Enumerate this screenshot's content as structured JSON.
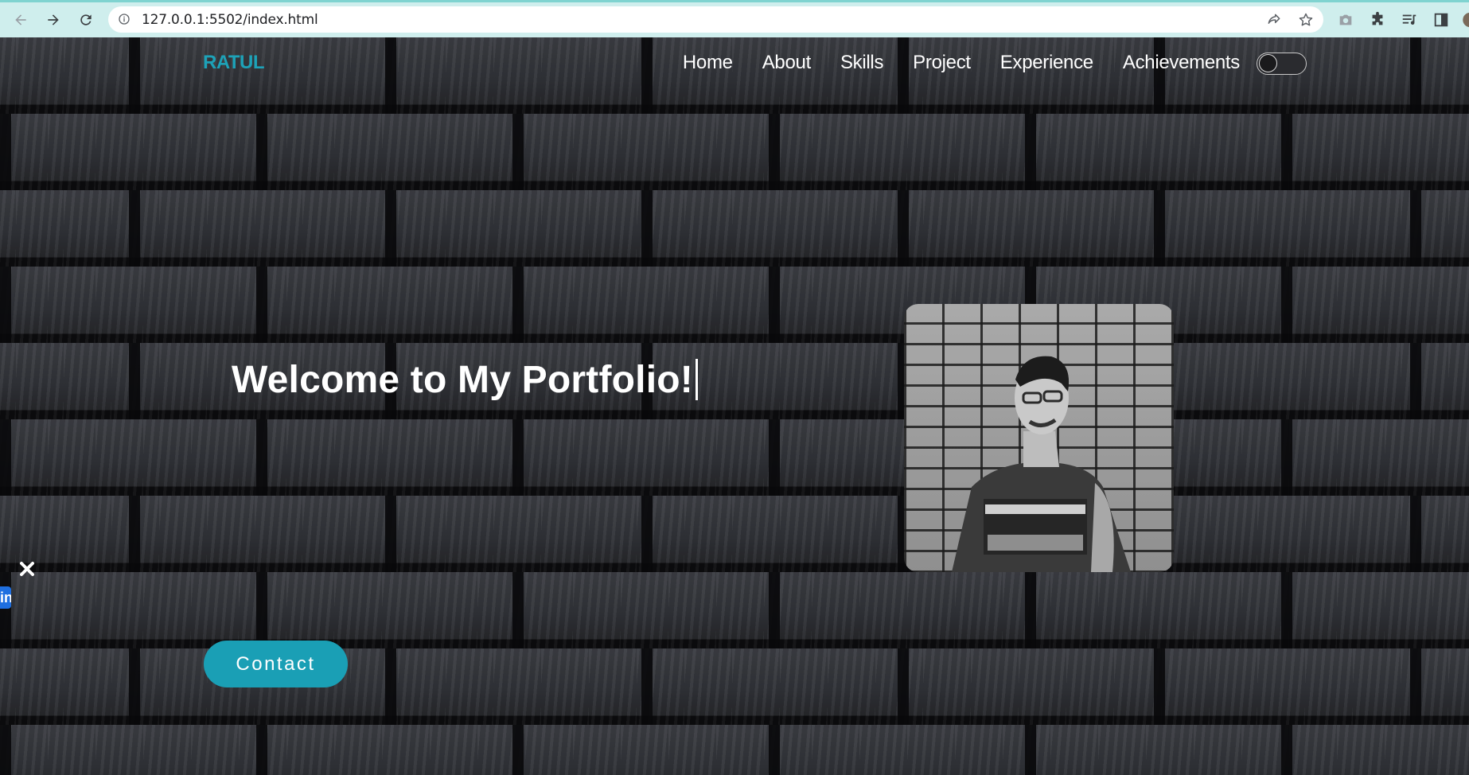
{
  "browser": {
    "url": "127.0.0.1:5502/index.html"
  },
  "site": {
    "logo": "RATUL",
    "nav": [
      "Home",
      "About",
      "Skills",
      "Project",
      "Experience",
      "Achievements"
    ],
    "theme_toggle": "off"
  },
  "hero": {
    "title": "Welcome to My Portfolio!",
    "contact_label": "Contact",
    "side_tab_label": "in"
  },
  "colors": {
    "accent": "#1a9fb5",
    "logo": "#1da2b8",
    "browser_bar": "#cfeeed",
    "side_tab": "#1f6fe0"
  },
  "icons": {
    "back": "arrow-left-icon",
    "forward": "arrow-right-icon",
    "reload": "reload-icon",
    "info": "info-icon",
    "share": "share-icon",
    "bookmark": "star-icon",
    "close": "close-icon"
  }
}
